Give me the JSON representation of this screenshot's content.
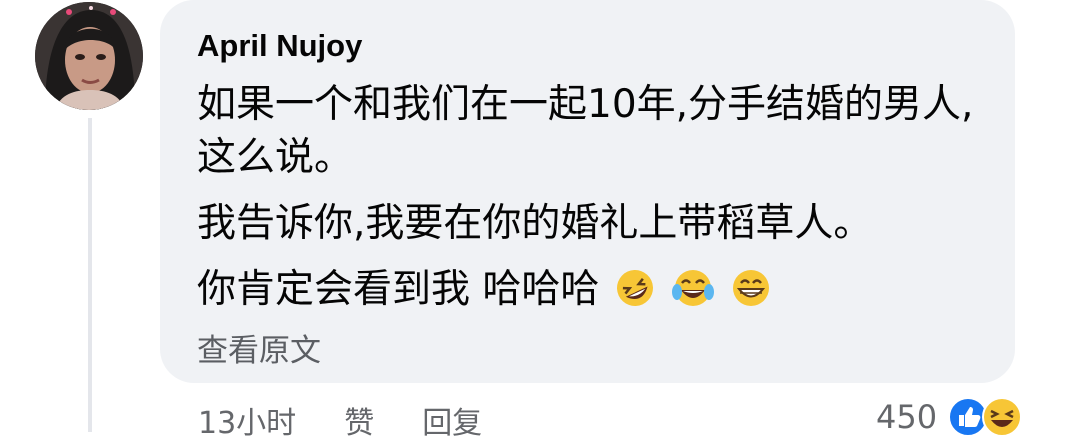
{
  "comment": {
    "author": "April Nujoy",
    "lines": [
      "如果一个和我们在一起10年,分手结婚的男人,这么说。",
      "我告诉你,我要在你的婚礼上带稻草人。",
      "你肯定会看到我 哈哈哈"
    ],
    "emojis": [
      "rolling-on-floor-laughing",
      "face-with-tears-of-joy",
      "grinning-face"
    ],
    "see_original": "查看原文",
    "timestamp": "13小时",
    "like_label": "赞",
    "reply_label": "回复",
    "reaction_count": "450",
    "reaction_icons": [
      "like-reaction-icon",
      "haha-reaction-icon"
    ]
  },
  "colors": {
    "bubble": "#f0f2f5",
    "meta_text": "#65676b",
    "like_blue": "#1877f2",
    "haha_yellow": "#f7c636"
  }
}
